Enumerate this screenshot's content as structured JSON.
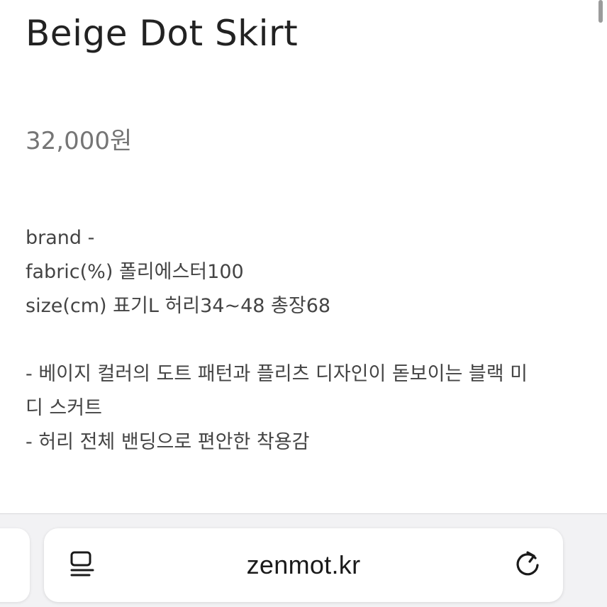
{
  "product": {
    "title": "Beige Dot Skirt",
    "price": "32,000원"
  },
  "details": {
    "brand": "brand -",
    "fabric": "fabric(%) 폴리에스터100",
    "size": "size(cm) 표기L 허리34~48 총장68"
  },
  "description": {
    "line1": "- 베이지 컬러의 도트 패턴과 플리츠 디자인이 돋보이는 블랙 미",
    "line2": "디 스커트",
    "line3": "- 허리 전체 밴딩으로 편안한 착용감"
  },
  "browser": {
    "url": "zenmot.kr",
    "reader_icon": "reader-mode-icon",
    "reload_icon": "reload-icon"
  },
  "colors": {
    "title": "#222222",
    "price": "#757575",
    "body_text": "#444444",
    "toolbar_bg": "#f2f2f4"
  }
}
